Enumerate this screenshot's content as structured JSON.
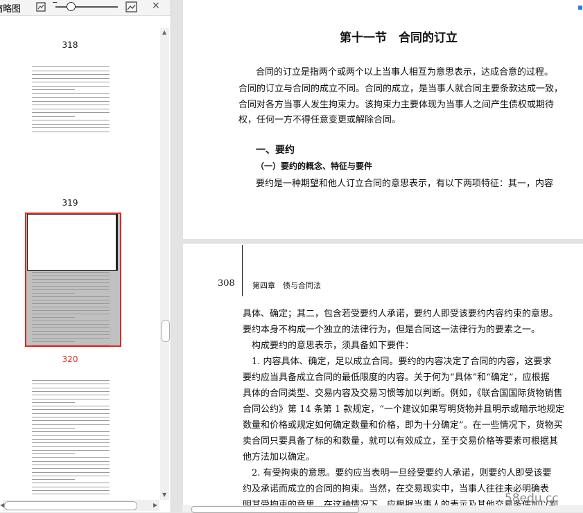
{
  "toolbar": {
    "label": "缩略图",
    "icons": [
      "thumbnail-small-icon",
      "zoom-slider",
      "thumbnail-large-icon",
      "close-icon"
    ],
    "close_glyph": "×"
  },
  "thumbnails": {
    "pages": [
      {
        "number": "318",
        "selected": false
      },
      {
        "number": "319",
        "selected": false
      },
      {
        "number": "320",
        "selected": true
      }
    ],
    "selected_color": "#e0281f"
  },
  "document": {
    "page_top": {
      "section_title": "第十一节　合同的订立",
      "paragraph1": [
        "合同的订立是指两个或两个以上当事人相互为意思表示，达成合意的过程。",
        "合同的订立与合同的成立不同。合同的成立，是当事人就合同主要条款达成一致，",
        "合同对各方当事人发生拘束力。该拘束力主要体现为当事人之间产生债权或期待",
        "权，任何一方不得任意变更或解除合同。"
      ],
      "heading1": "一、要约",
      "heading2": "（一）要约的概念、特征与要件",
      "paragraph2": "要约是一种期望和他人订立合同的意思表示，有以下两项特征：其一，内容"
    },
    "page_bottom": {
      "page_number": "308",
      "running_header": "第四章　债与合同法",
      "lines": [
        "具体、确定；其二，包含若受要约人承诺，要约人即受该要约内容约束的意思。",
        "要约本身不构成一个独立的法律行为，但是合同这一法律行为的要素之一。",
        "　构成要约的意思表示，须具备如下要件：",
        "　1. 内容具体、确定，足以成立合同。要约的内容决定了合同的内容，这要求",
        "要约应当具备成立合同的最低限度的内容。关于何为“具体”和“确定”，应根据",
        "具体的合同类型、交易内容及交易习惯等加以判断。例如，《联合国国际货物销售",
        "合同公约》第 14 条第 1 款规定，“一个建议如果写明货物并且明示或暗示地规定",
        "数量和价格或规定如何确定数量和价格，即为十分确定”。在一些情况下，货物买",
        "卖合同只要具备了标的和数量，就可以有效成立，至于交易价格等要素可根据其",
        "他方法加以确定。",
        "　2. 有受拘束的意思。要约应当表明一旦经受要约人承诺，则要约人即受该要",
        "约及承诺而成立的合同的拘束。当然，在交易现实中，当事人往往未必明确表",
        "明其受拘束的意思，在这种情况下，应根据当事人的表示及其他交易条件加以判"
      ]
    },
    "watermark": "58edu.cc"
  },
  "colors": {
    "accent": "#2c7ae6",
    "selected_border": "#e0281f",
    "pane_bg": "#ffffff",
    "doc_bg": "#e3e3e3"
  }
}
